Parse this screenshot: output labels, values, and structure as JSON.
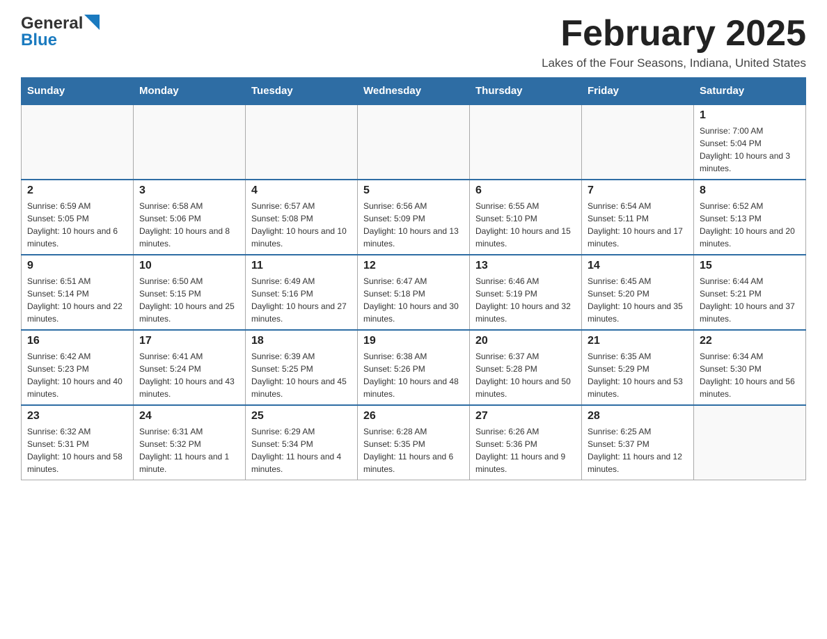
{
  "header": {
    "logo_general": "General",
    "logo_blue": "Blue",
    "month_title": "February 2025",
    "subtitle": "Lakes of the Four Seasons, Indiana, United States"
  },
  "days_of_week": [
    "Sunday",
    "Monday",
    "Tuesday",
    "Wednesday",
    "Thursday",
    "Friday",
    "Saturday"
  ],
  "weeks": [
    [
      {
        "day": "",
        "info": ""
      },
      {
        "day": "",
        "info": ""
      },
      {
        "day": "",
        "info": ""
      },
      {
        "day": "",
        "info": ""
      },
      {
        "day": "",
        "info": ""
      },
      {
        "day": "",
        "info": ""
      },
      {
        "day": "1",
        "info": "Sunrise: 7:00 AM\nSunset: 5:04 PM\nDaylight: 10 hours and 3 minutes."
      }
    ],
    [
      {
        "day": "2",
        "info": "Sunrise: 6:59 AM\nSunset: 5:05 PM\nDaylight: 10 hours and 6 minutes."
      },
      {
        "day": "3",
        "info": "Sunrise: 6:58 AM\nSunset: 5:06 PM\nDaylight: 10 hours and 8 minutes."
      },
      {
        "day": "4",
        "info": "Sunrise: 6:57 AM\nSunset: 5:08 PM\nDaylight: 10 hours and 10 minutes."
      },
      {
        "day": "5",
        "info": "Sunrise: 6:56 AM\nSunset: 5:09 PM\nDaylight: 10 hours and 13 minutes."
      },
      {
        "day": "6",
        "info": "Sunrise: 6:55 AM\nSunset: 5:10 PM\nDaylight: 10 hours and 15 minutes."
      },
      {
        "day": "7",
        "info": "Sunrise: 6:54 AM\nSunset: 5:11 PM\nDaylight: 10 hours and 17 minutes."
      },
      {
        "day": "8",
        "info": "Sunrise: 6:52 AM\nSunset: 5:13 PM\nDaylight: 10 hours and 20 minutes."
      }
    ],
    [
      {
        "day": "9",
        "info": "Sunrise: 6:51 AM\nSunset: 5:14 PM\nDaylight: 10 hours and 22 minutes."
      },
      {
        "day": "10",
        "info": "Sunrise: 6:50 AM\nSunset: 5:15 PM\nDaylight: 10 hours and 25 minutes."
      },
      {
        "day": "11",
        "info": "Sunrise: 6:49 AM\nSunset: 5:16 PM\nDaylight: 10 hours and 27 minutes."
      },
      {
        "day": "12",
        "info": "Sunrise: 6:47 AM\nSunset: 5:18 PM\nDaylight: 10 hours and 30 minutes."
      },
      {
        "day": "13",
        "info": "Sunrise: 6:46 AM\nSunset: 5:19 PM\nDaylight: 10 hours and 32 minutes."
      },
      {
        "day": "14",
        "info": "Sunrise: 6:45 AM\nSunset: 5:20 PM\nDaylight: 10 hours and 35 minutes."
      },
      {
        "day": "15",
        "info": "Sunrise: 6:44 AM\nSunset: 5:21 PM\nDaylight: 10 hours and 37 minutes."
      }
    ],
    [
      {
        "day": "16",
        "info": "Sunrise: 6:42 AM\nSunset: 5:23 PM\nDaylight: 10 hours and 40 minutes."
      },
      {
        "day": "17",
        "info": "Sunrise: 6:41 AM\nSunset: 5:24 PM\nDaylight: 10 hours and 43 minutes."
      },
      {
        "day": "18",
        "info": "Sunrise: 6:39 AM\nSunset: 5:25 PM\nDaylight: 10 hours and 45 minutes."
      },
      {
        "day": "19",
        "info": "Sunrise: 6:38 AM\nSunset: 5:26 PM\nDaylight: 10 hours and 48 minutes."
      },
      {
        "day": "20",
        "info": "Sunrise: 6:37 AM\nSunset: 5:28 PM\nDaylight: 10 hours and 50 minutes."
      },
      {
        "day": "21",
        "info": "Sunrise: 6:35 AM\nSunset: 5:29 PM\nDaylight: 10 hours and 53 minutes."
      },
      {
        "day": "22",
        "info": "Sunrise: 6:34 AM\nSunset: 5:30 PM\nDaylight: 10 hours and 56 minutes."
      }
    ],
    [
      {
        "day": "23",
        "info": "Sunrise: 6:32 AM\nSunset: 5:31 PM\nDaylight: 10 hours and 58 minutes."
      },
      {
        "day": "24",
        "info": "Sunrise: 6:31 AM\nSunset: 5:32 PM\nDaylight: 11 hours and 1 minute."
      },
      {
        "day": "25",
        "info": "Sunrise: 6:29 AM\nSunset: 5:34 PM\nDaylight: 11 hours and 4 minutes."
      },
      {
        "day": "26",
        "info": "Sunrise: 6:28 AM\nSunset: 5:35 PM\nDaylight: 11 hours and 6 minutes."
      },
      {
        "day": "27",
        "info": "Sunrise: 6:26 AM\nSunset: 5:36 PM\nDaylight: 11 hours and 9 minutes."
      },
      {
        "day": "28",
        "info": "Sunrise: 6:25 AM\nSunset: 5:37 PM\nDaylight: 11 hours and 12 minutes."
      },
      {
        "day": "",
        "info": ""
      }
    ]
  ]
}
